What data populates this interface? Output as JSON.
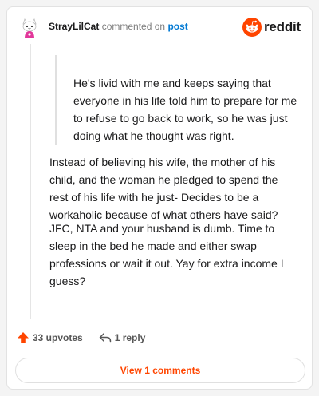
{
  "header": {
    "username": "StrayLilCat",
    "action_text": "commented on",
    "post_link": "post",
    "brand": "reddit",
    "icons": {
      "avatar": "snoo-avatar-icon",
      "logo": "reddit-snoo-icon"
    }
  },
  "comment": {
    "quote": "He's livid with me and keeps saying that everyone in his life told him to prepare for me to refuse to go back to work, so he was just doing what he thought was right.",
    "paragraphs": [
      "Instead of believing his wife, the mother of his child, and the woman he pledged to spend the rest of his life with he just- Decides to be a workaholic because of what others have said?",
      "JFC, NTA and your husband is dumb. Time to sleep in the bed he made and either swap professions or wait it out. Yay for extra income I guess?"
    ]
  },
  "actions": {
    "upvotes": "33 upvotes",
    "replies": "1 reply",
    "view_comments": "View 1 comments"
  },
  "colors": {
    "accent": "#ff4500",
    "link": "#0079d3",
    "text": "#1a1a1b",
    "muted": "#7c7c7c"
  }
}
